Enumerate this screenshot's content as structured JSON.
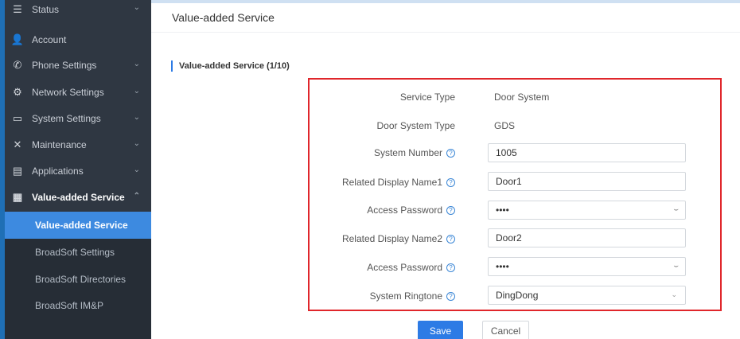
{
  "sidebar": {
    "items": [
      {
        "label": "Status",
        "icon": "status-icon",
        "glyph": "☰",
        "chevron": "⌄"
      },
      {
        "label": "Account",
        "icon": "account-icon",
        "glyph": "👤",
        "chevron": ""
      },
      {
        "label": "Phone Settings",
        "icon": "phone-icon",
        "glyph": "✆",
        "chevron": "⌄"
      },
      {
        "label": "Network Settings",
        "icon": "network-icon",
        "glyph": "⚙",
        "chevron": "⌄"
      },
      {
        "label": "System Settings",
        "icon": "system-icon",
        "glyph": "▭",
        "chevron": "⌄"
      },
      {
        "label": "Maintenance",
        "icon": "maintenance-icon",
        "glyph": "✕",
        "chevron": "⌄"
      },
      {
        "label": "Applications",
        "icon": "applications-icon",
        "glyph": "▤",
        "chevron": "⌄"
      },
      {
        "label": "Value-added Service",
        "icon": "value-added-icon",
        "glyph": "▦",
        "chevron": "⌃"
      }
    ],
    "subitems": [
      {
        "label": "Value-added Service",
        "active": true
      },
      {
        "label": "BroadSoft Settings",
        "active": false
      },
      {
        "label": "BroadSoft Directories",
        "active": false
      },
      {
        "label": "BroadSoft IM&P",
        "active": false
      }
    ]
  },
  "page": {
    "title": "Value-added Service",
    "section_title": "Value-added Service (1/10)"
  },
  "form": {
    "service_type": {
      "label": "Service Type",
      "value": "Door System"
    },
    "door_system_type": {
      "label": "Door System Type",
      "value": "GDS"
    },
    "system_number": {
      "label": "System Number",
      "value": "1005"
    },
    "related_display_name1": {
      "label": "Related Display Name1",
      "value": "Door1"
    },
    "access_password1": {
      "label": "Access Password",
      "value": "••••"
    },
    "related_display_name2": {
      "label": "Related Display Name2",
      "value": "Door2"
    },
    "access_password2": {
      "label": "Access Password",
      "value": "••••"
    },
    "system_ringtone": {
      "label": "System Ringtone",
      "value": "DingDong"
    }
  },
  "buttons": {
    "save": "Save",
    "cancel": "Cancel"
  },
  "colors": {
    "accent": "#2d7be5",
    "sidebar": "#2f3742",
    "highlight": "#e0262b"
  }
}
